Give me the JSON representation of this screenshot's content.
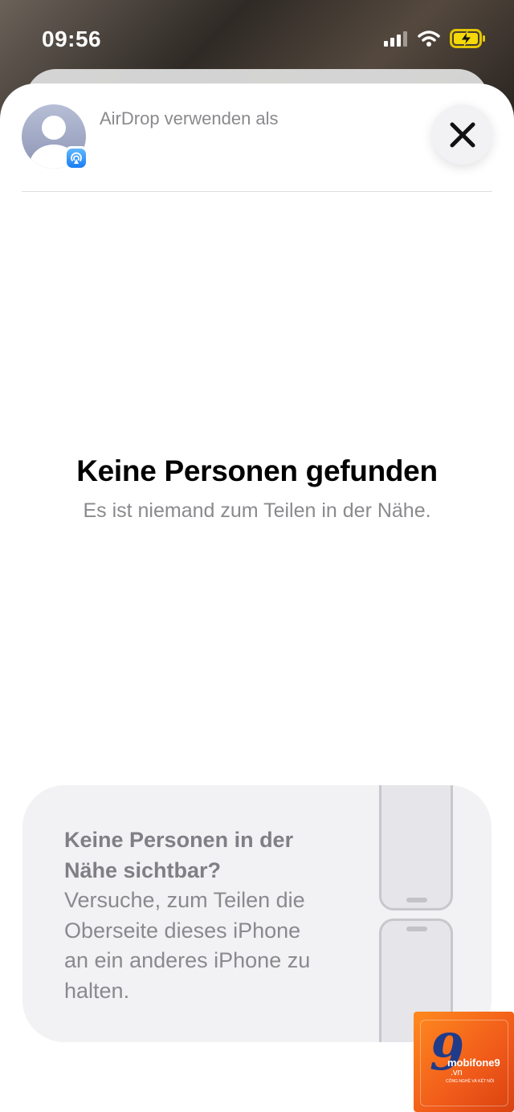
{
  "status_bar": {
    "time": "09:56",
    "icons": [
      "cellular-signal-icon",
      "wifi-icon",
      "battery-charging-icon"
    ]
  },
  "header": {
    "airdrop_label": "AirDrop verwenden als",
    "avatar_icon": "person-icon",
    "badge_icon": "airdrop-icon",
    "close_icon": "close-icon"
  },
  "empty_state": {
    "title": "Keine Personen gefunden",
    "subtitle": "Es ist niemand zum Teilen in der Nähe."
  },
  "hint_card": {
    "title": "Keine Personen in der Nähe sichtbar?",
    "body": "Versuche, zum Teilen die Oberseite dieses iPhone an ein anderes iPhone zu halten.",
    "illustration_icon": "two-iphones-icon"
  },
  "watermark": {
    "logo_text": "9",
    "brand": "mobifone9",
    "domain": ".vn",
    "slogan": "CÔNG NGHỆ VÀ KẾT NỐI"
  },
  "colors": {
    "secondary_text": "#8a8a8e",
    "card_background": "#f2f2f4",
    "airdrop_blue": "#1a7cf5",
    "watermark_orange": "#f05a1a"
  }
}
